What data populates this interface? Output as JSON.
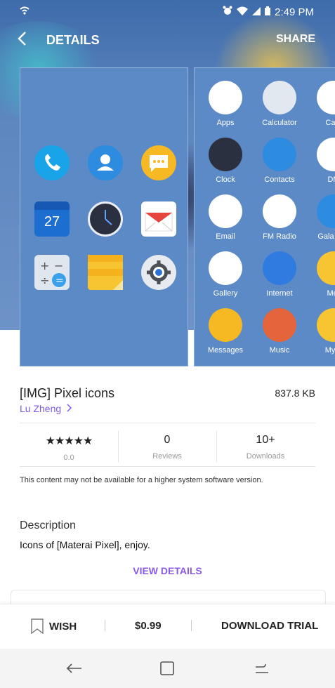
{
  "status_bar": {
    "time": "2:49 PM"
  },
  "app_bar": {
    "title": "DETAILS",
    "share_label": "SHARE"
  },
  "screenshot1": {
    "calendar_day": "27"
  },
  "screenshot2": {
    "apps": [
      {
        "label": "Apps",
        "color": "#ffffff"
      },
      {
        "label": "Calculator",
        "color": "#e2e8ef"
      },
      {
        "label": "Cam",
        "color": "#ffffff"
      },
      {
        "label": "Clock",
        "color": "#2b3040"
      },
      {
        "label": "Contacts",
        "color": "#2d8be0"
      },
      {
        "label": "DM",
        "color": "#ffffff"
      },
      {
        "label": "Email",
        "color": "#ffffff"
      },
      {
        "label": "FM Radio",
        "color": "#ffffff"
      },
      {
        "label": "Gala App",
        "color": "#2d8be0"
      },
      {
        "label": "Gallery",
        "color": "#ffffff"
      },
      {
        "label": "Internet",
        "color": "#2f7be0"
      },
      {
        "label": "Mer",
        "color": "#f7c531"
      },
      {
        "label": "Messages",
        "color": "#f6b823"
      },
      {
        "label": "Music",
        "color": "#e4643b"
      },
      {
        "label": "My F",
        "color": "#f7c531"
      }
    ]
  },
  "app": {
    "title": "[IMG] Pixel icons",
    "size": "837.8 KB",
    "author": "Lu Zheng",
    "rating_stars": "★★★★★",
    "rating_value": "0.0",
    "reviews_value": "0",
    "reviews_label": "Reviews",
    "downloads_value": "10+",
    "downloads_label": "Downloads",
    "compat_warning": "This content may not be available for a higher system software version.",
    "description_heading": "Description",
    "description_text": "Icons of [Materai Pixel], enjoy.",
    "view_details_label": "VIEW DETAILS"
  },
  "bottom_bar": {
    "wish_label": "WISH",
    "price_label": "$0.99",
    "trial_label": "DOWNLOAD TRIAL"
  }
}
